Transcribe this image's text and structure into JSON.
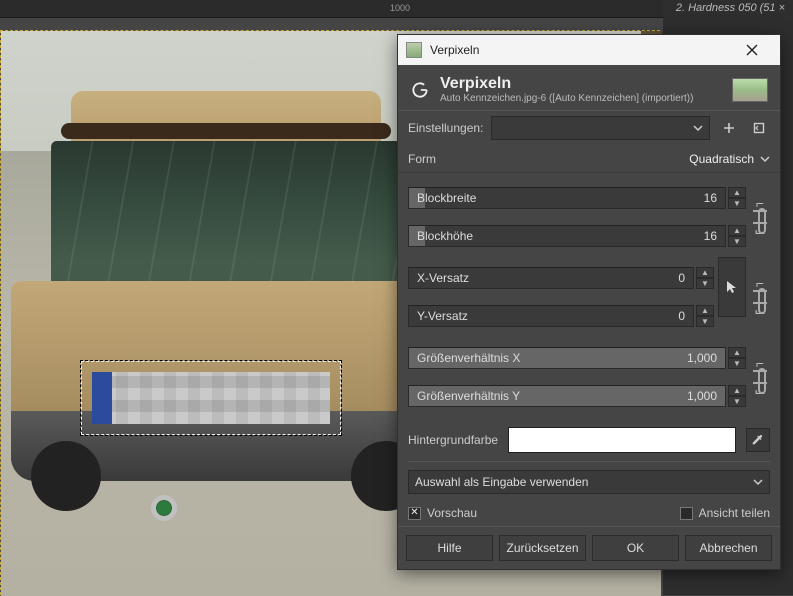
{
  "ruler": {
    "tick_1000": "1000"
  },
  "right_strip": {
    "hardness_hint": "2. Hardness 050 (51 ×"
  },
  "dialog": {
    "window_title": "Verpixeln",
    "header_title": "Verpixeln",
    "header_sub": "Auto Kennzeichen.jpg-6 ([Auto Kennzeichen] (importiert))",
    "presets_label": "Einstellungen:",
    "shape_label": "Form",
    "shape_selected": "Quadratisch",
    "params": {
      "block_w_label": "Blockbreite",
      "block_w_value": "16",
      "block_h_label": "Blockhöhe",
      "block_h_value": "16",
      "xoff_label": "X-Versatz",
      "xoff_value": "0",
      "yoff_label": "Y-Versatz",
      "yoff_value": "0",
      "ratiox_label": "Größenverhältnis X",
      "ratiox_value": "1,000",
      "ratioy_label": "Größenverhältnis Y",
      "ratioy_value": "1,000"
    },
    "bg_label": "Hintergrundfarbe",
    "bg_color": "#ffffff",
    "usage_selected": "Auswahl als Eingabe verwenden",
    "preview_label": "Vorschau",
    "split_label": "Ansicht teilen",
    "preview_checked": true,
    "split_checked": false,
    "buttons": {
      "help": "Hilfe",
      "reset": "Zurücksetzen",
      "ok": "OK",
      "cancel": "Abbrechen"
    }
  }
}
